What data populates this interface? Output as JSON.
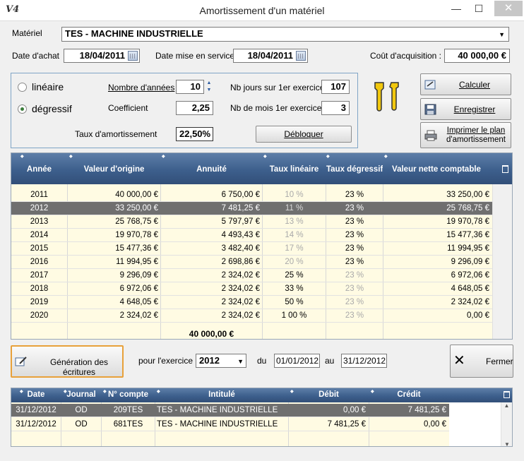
{
  "window": {
    "title": "Amortissement d'un matériel",
    "app_icon": "V4",
    "minimize": "—",
    "maximize": "☐",
    "close": "✕"
  },
  "header": {
    "materiel_label": "Matériel",
    "materiel_value": "TES - MACHINE INDUSTRIELLE",
    "date_achat_label": "Date d'achat",
    "date_achat_value": "18/04/2011",
    "date_service_label": "Date mise en service",
    "date_service_value": "18/04/2011",
    "cout_label": "Coût d'acquisition :",
    "cout_value": "40 000,00 €"
  },
  "params": {
    "lineaire_label": "linéaire",
    "degressif_label": "dégressif",
    "selected_mode": "dégressif",
    "nb_annees_label": "Nombre d'années",
    "nb_annees_value": "10",
    "coefficient_label": "Coefficient",
    "coefficient_value": "2,25",
    "taux_label": "Taux d'amortissement",
    "taux_value": "22,50%",
    "nb_jours_label": "Nb jours sur 1er exercice",
    "nb_jours_value": "107",
    "nb_mois_label": "Nb de mois 1er exercice",
    "nb_mois_value": "3",
    "debloquer_label": "Débloquer"
  },
  "actions": {
    "calculer": "Calculer",
    "enregistrer": "Enregistrer",
    "imprimer_line1": "Imprimer le plan",
    "imprimer_line2": "d'amortissement"
  },
  "plan": {
    "columns": [
      "Année",
      "Valeur d'origine",
      "Annuité",
      "Taux linéaire",
      "Taux dégressif",
      "Valeur nette comptable"
    ],
    "rows": [
      {
        "annee": "2011",
        "origine": "40 000,00 €",
        "annuite": "6 750,00 €",
        "lin": "10 %",
        "deg": "23 %",
        "vnc": "33 250,00 €",
        "lin_grey": true,
        "deg_grey": false
      },
      {
        "annee": "2012",
        "origine": "33 250,00 €",
        "annuite": "7 481,25 €",
        "lin": "11 %",
        "deg": "23 %",
        "vnc": "25 768,75 €",
        "lin_grey": true,
        "deg_grey": false
      },
      {
        "annee": "2013",
        "origine": "25 768,75 €",
        "annuite": "5 797,97 €",
        "lin": "13 %",
        "deg": "23 %",
        "vnc": "19 970,78 €",
        "lin_grey": true,
        "deg_grey": false
      },
      {
        "annee": "2014",
        "origine": "19 970,78 €",
        "annuite": "4 493,43 €",
        "lin": "14 %",
        "deg": "23 %",
        "vnc": "15 477,36 €",
        "lin_grey": true,
        "deg_grey": false
      },
      {
        "annee": "2015",
        "origine": "15 477,36 €",
        "annuite": "3 482,40 €",
        "lin": "17 %",
        "deg": "23 %",
        "vnc": "11 994,95 €",
        "lin_grey": true,
        "deg_grey": false
      },
      {
        "annee": "2016",
        "origine": "11 994,95 €",
        "annuite": "2 698,86 €",
        "lin": "20 %",
        "deg": "23 %",
        "vnc": "9 296,09 €",
        "lin_grey": true,
        "deg_grey": false
      },
      {
        "annee": "2017",
        "origine": "9 296,09 €",
        "annuite": "2 324,02 €",
        "lin": "25 %",
        "deg": "23 %",
        "vnc": "6 972,06 €",
        "lin_grey": false,
        "deg_grey": true
      },
      {
        "annee": "2018",
        "origine": "6 972,06 €",
        "annuite": "2 324,02 €",
        "lin": "33 %",
        "deg": "23 %",
        "vnc": "4 648,05 €",
        "lin_grey": false,
        "deg_grey": true
      },
      {
        "annee": "2019",
        "origine": "4 648,05 €",
        "annuite": "2 324,02 €",
        "lin": "50 %",
        "deg": "23 %",
        "vnc": "2 324,02 €",
        "lin_grey": false,
        "deg_grey": true
      },
      {
        "annee": "2020",
        "origine": "2 324,02 €",
        "annuite": "2 324,02 €",
        "lin": "1 00 %",
        "deg": "23 %",
        "vnc": "0,00 €",
        "lin_grey": false,
        "deg_grey": true
      }
    ],
    "selected_index": 1,
    "total_annuite": "40 000,00 €"
  },
  "generation": {
    "button_label": "Génération des écritures",
    "exercice_label": "pour l'exercice",
    "exercice_value": "2012",
    "du_label": "du",
    "du_value": "01/01/2012",
    "au_label": "au",
    "au_value": "31/12/2012",
    "fermer_label": "Fermer"
  },
  "ecritures": {
    "columns": [
      "Date",
      "Journal",
      "N° compte",
      "Intitulé",
      "Débit",
      "Crédit"
    ],
    "rows": [
      {
        "date": "31/12/2012",
        "journal": "OD",
        "compte": "209TES",
        "intitule": "TES - MACHINE INDUSTRIELLE",
        "debit": "0,00 €",
        "credit": "7 481,25 €"
      },
      {
        "date": "31/12/2012",
        "journal": "OD",
        "compte": "681TES",
        "intitule": "TES - MACHINE INDUSTRIELLE",
        "debit": "7 481,25 €",
        "credit": "0,00 €"
      }
    ],
    "selected_index": 0
  },
  "colors": {
    "header_blue": "#3d5f8c",
    "row_yellow": "#fffbe3",
    "selected_row": "#6f6f6f",
    "group_border": "#7fa4c6"
  }
}
